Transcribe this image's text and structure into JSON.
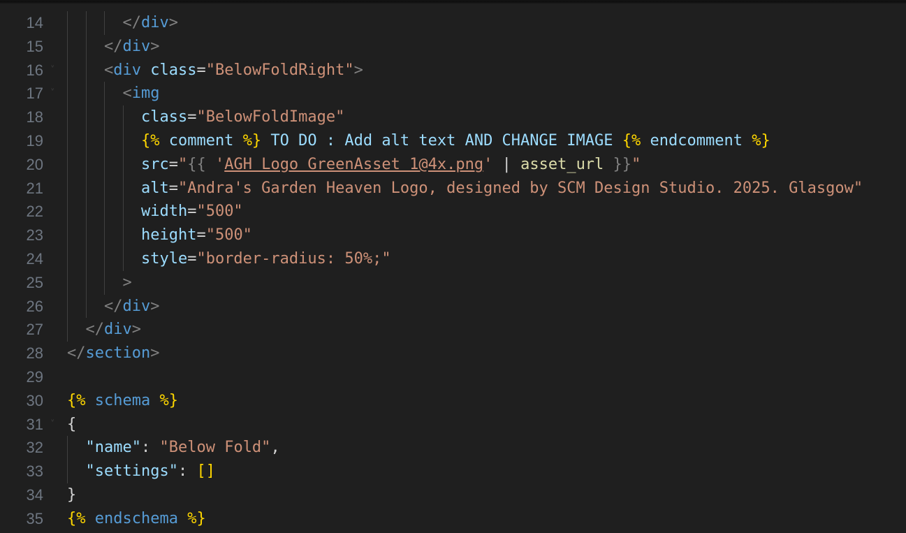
{
  "editor": {
    "lines": [
      {
        "number": "14",
        "segments": [
          {
            "t": "</",
            "c": "tag-punct"
          },
          {
            "t": "div",
            "c": "tag"
          },
          {
            "t": ">",
            "c": "tag-punct"
          }
        ],
        "indent": "      "
      },
      {
        "number": "15",
        "segments": [
          {
            "t": "</",
            "c": "tag-punct"
          },
          {
            "t": "div",
            "c": "tag"
          },
          {
            "t": ">",
            "c": "tag-punct"
          }
        ],
        "indent": "    "
      },
      {
        "number": "16",
        "segments": [
          {
            "t": "<",
            "c": "tag-punct"
          },
          {
            "t": "div",
            "c": "tag"
          },
          {
            "t": " ",
            "c": "plain"
          },
          {
            "t": "class",
            "c": "attr"
          },
          {
            "t": "=",
            "c": "eq"
          },
          {
            "t": "\"BelowFoldRight\"",
            "c": "str"
          },
          {
            "t": ">",
            "c": "tag-punct"
          }
        ],
        "indent": "    "
      },
      {
        "number": "17",
        "segments": [
          {
            "t": "<",
            "c": "tag-punct"
          },
          {
            "t": "img",
            "c": "tag"
          }
        ],
        "indent": "      "
      },
      {
        "number": "18",
        "segments": [
          {
            "t": "class",
            "c": "attr"
          },
          {
            "t": "=",
            "c": "eq"
          },
          {
            "t": "\"BelowFoldImage\"",
            "c": "str"
          }
        ],
        "indent": "        "
      },
      {
        "number": "19",
        "segments": [
          {
            "t": "{%",
            "c": "liquid-brace"
          },
          {
            "t": " comment ",
            "c": "liquid-text"
          },
          {
            "t": "%}",
            "c": "liquid-brace"
          },
          {
            "t": " TO DO : Add alt text AND CHANGE IMAGE ",
            "c": "liquid-text"
          },
          {
            "t": "{%",
            "c": "liquid-brace"
          },
          {
            "t": " endcomment ",
            "c": "liquid-text"
          },
          {
            "t": "%}",
            "c": "liquid-brace"
          }
        ],
        "indent": "        "
      },
      {
        "number": "20",
        "segments": [
          {
            "t": "src",
            "c": "attr"
          },
          {
            "t": "=",
            "c": "eq"
          },
          {
            "t": "\"",
            "c": "str"
          },
          {
            "t": "{{",
            "c": "tag-punct"
          },
          {
            "t": " '",
            "c": "str"
          },
          {
            "t": "AGH Logo GreenAsset 1@4x.png",
            "c": "str underline"
          },
          {
            "t": "'",
            "c": "str"
          },
          {
            "t": " | ",
            "c": "plain"
          },
          {
            "t": "asset_url",
            "c": "filter"
          },
          {
            "t": " }}",
            "c": "tag-punct"
          },
          {
            "t": "\"",
            "c": "str"
          }
        ],
        "indent": "        "
      },
      {
        "number": "21",
        "segments": [
          {
            "t": "alt",
            "c": "attr"
          },
          {
            "t": "=",
            "c": "eq"
          },
          {
            "t": "\"Andra's Garden Heaven Logo, designed by SCM Design Studio. 2025. Glasgow\"",
            "c": "str"
          }
        ],
        "indent": "        "
      },
      {
        "number": "22",
        "segments": [
          {
            "t": "width",
            "c": "attr"
          },
          {
            "t": "=",
            "c": "eq"
          },
          {
            "t": "\"500\"",
            "c": "str"
          }
        ],
        "indent": "        "
      },
      {
        "number": "23",
        "segments": [
          {
            "t": "height",
            "c": "attr"
          },
          {
            "t": "=",
            "c": "eq"
          },
          {
            "t": "\"500\"",
            "c": "str"
          }
        ],
        "indent": "        "
      },
      {
        "number": "24",
        "segments": [
          {
            "t": "style",
            "c": "attr"
          },
          {
            "t": "=",
            "c": "eq"
          },
          {
            "t": "\"border-radius: 50%;\"",
            "c": "str"
          }
        ],
        "indent": "        "
      },
      {
        "number": "25",
        "segments": [
          {
            "t": ">",
            "c": "tag-punct"
          }
        ],
        "indent": "      "
      },
      {
        "number": "26",
        "segments": [
          {
            "t": "</",
            "c": "tag-punct"
          },
          {
            "t": "div",
            "c": "tag"
          },
          {
            "t": ">",
            "c": "tag-punct"
          }
        ],
        "indent": "    "
      },
      {
        "number": "27",
        "segments": [
          {
            "t": "</",
            "c": "tag-punct"
          },
          {
            "t": "div",
            "c": "tag"
          },
          {
            "t": ">",
            "c": "tag-punct"
          }
        ],
        "indent": "  "
      },
      {
        "number": "28",
        "segments": [
          {
            "t": "</",
            "c": "tag-punct"
          },
          {
            "t": "section",
            "c": "tag"
          },
          {
            "t": ">",
            "c": "tag-punct"
          }
        ],
        "indent": ""
      },
      {
        "number": "29",
        "segments": [],
        "indent": ""
      },
      {
        "number": "30",
        "segments": [
          {
            "t": "{%",
            "c": "liquid-brace"
          },
          {
            "t": " schema ",
            "c": "kw"
          },
          {
            "t": "%}",
            "c": "liquid-brace"
          }
        ],
        "indent": ""
      },
      {
        "number": "31",
        "segments": [
          {
            "t": "{",
            "c": "plain"
          }
        ],
        "indent": ""
      },
      {
        "number": "32",
        "segments": [
          {
            "t": "\"name\"",
            "c": "liquid-text"
          },
          {
            "t": ": ",
            "c": "plain"
          },
          {
            "t": "\"Below Fold\"",
            "c": "str"
          },
          {
            "t": ",",
            "c": "plain"
          }
        ],
        "indent": "  "
      },
      {
        "number": "33",
        "segments": [
          {
            "t": "\"settings\"",
            "c": "liquid-text"
          },
          {
            "t": ": ",
            "c": "plain"
          },
          {
            "t": "[]",
            "c": "bracket"
          }
        ],
        "indent": "  "
      },
      {
        "number": "34",
        "segments": [
          {
            "t": "}",
            "c": "plain"
          }
        ],
        "indent": ""
      },
      {
        "number": "35",
        "segments": [
          {
            "t": "{%",
            "c": "liquid-brace"
          },
          {
            "t": " endschema ",
            "c": "kw"
          },
          {
            "t": "%}",
            "c": "liquid-brace"
          }
        ],
        "indent": ""
      }
    ],
    "fold_lines": [
      "16",
      "17",
      "31"
    ],
    "fold_icon": "chevron-down-icon"
  }
}
